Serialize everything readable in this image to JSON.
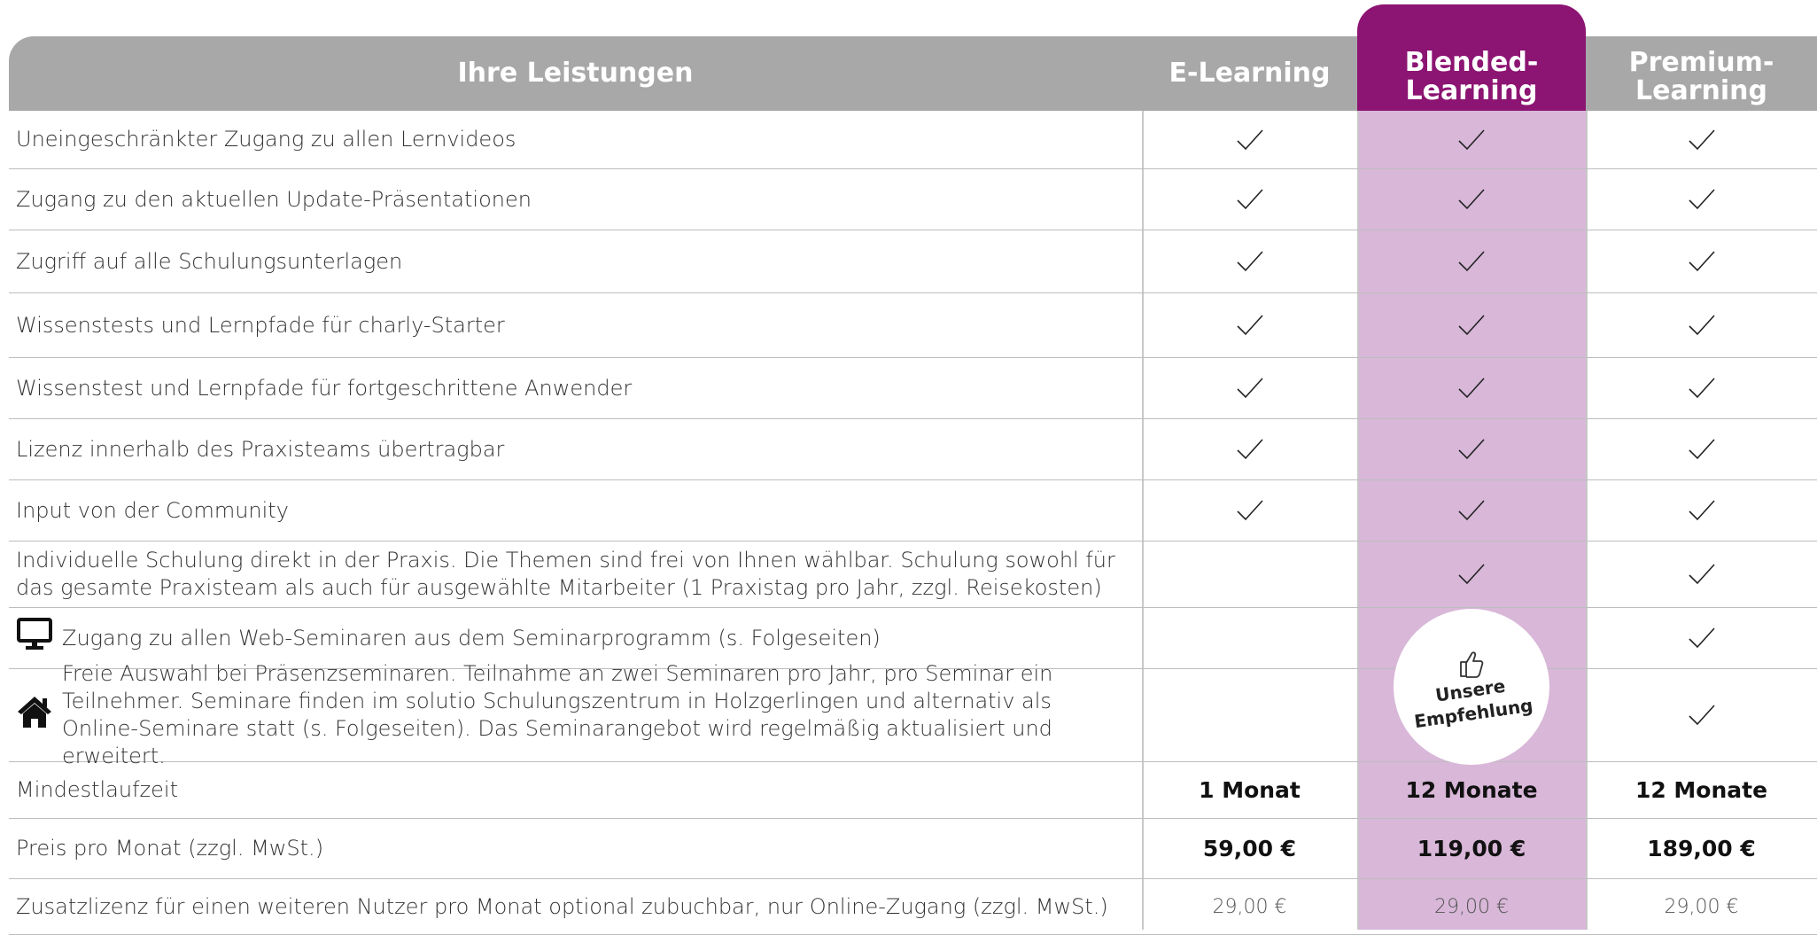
{
  "header": {
    "col_features": "Ihre Leistungen",
    "col_elearning": "E-Learning",
    "col_blended": "Blended-\nLearning",
    "col_premium": "Premium-\nLearning"
  },
  "rows": [
    {
      "label": "Uneingeschränkter Zugang zu allen Lernvideos",
      "e": true,
      "b": true,
      "p": true
    },
    {
      "label": "Zugang zu den aktuellen Update-Präsentationen",
      "e": true,
      "b": true,
      "p": true
    },
    {
      "label": "Zugriff auf alle Schulungsunterlagen",
      "e": true,
      "b": true,
      "p": true
    },
    {
      "label": "Wissenstests und Lernpfade für charly-Starter",
      "e": true,
      "b": true,
      "p": true
    },
    {
      "label": "Wissenstest und Lernpfade für fortgeschrittene Anwender",
      "e": true,
      "b": true,
      "p": true
    },
    {
      "label": "Lizenz innerhalb des Praxisteams übertragbar",
      "e": true,
      "b": true,
      "p": true
    },
    {
      "label": "Input von der Community",
      "e": true,
      "b": true,
      "p": true
    },
    {
      "label": "Individuelle Schulung direkt in der Praxis. Die Themen sind frei von Ihnen wählbar. Schulung sowohl für das gesamte Praxisteam als auch für ausgewählte Mitarbeiter (1 Praxistag pro Jahr, zzgl. Reisekosten)",
      "e": false,
      "b": true,
      "p": true
    },
    {
      "label": "Zugang zu allen Web-Seminaren aus dem Seminarprogramm (s. Folgeseiten)",
      "icon": "monitor-icon",
      "e": false,
      "b": false,
      "p": true
    },
    {
      "label": "Freie Auswahl bei Präsenzseminaren. Teilnahme an zwei Seminaren pro Jahr, pro Seminar ein Teilnehmer. Seminare finden im solutio Schulungszentrum in Holzgerlingen und alternativ als Online-Seminare statt (s. Folgeseiten). Das Seminarangebot wird regelmäßig aktualisiert und erweitert.",
      "icon": "house-icon",
      "e": false,
      "b": false,
      "p": true
    }
  ],
  "recommendation": {
    "label": "Unsere\nEmpfehlung",
    "icon": "thumbs-up-icon"
  },
  "min_term": {
    "label": "Mindestlaufzeit",
    "e": "1 Monat",
    "b": "12 Monate",
    "p": "12 Monate"
  },
  "price": {
    "label": "Preis pro Monat (zzgl. MwSt.)",
    "e": "59,00 €",
    "b": "119,00 €",
    "p": "189,00 €"
  },
  "extra": {
    "label": "Zusatzlizenz für einen weiteren Nutzer pro Monat optional zubuchbar, nur Online-Zugang (zzgl. MwSt.)",
    "e": "29,00 €",
    "b": "29,00 €",
    "p": "29,00 €"
  },
  "colors": {
    "header_grey": "#a8a8a8",
    "blended_accent": "#8c1472",
    "blended_fill": "#d8b7d8"
  }
}
